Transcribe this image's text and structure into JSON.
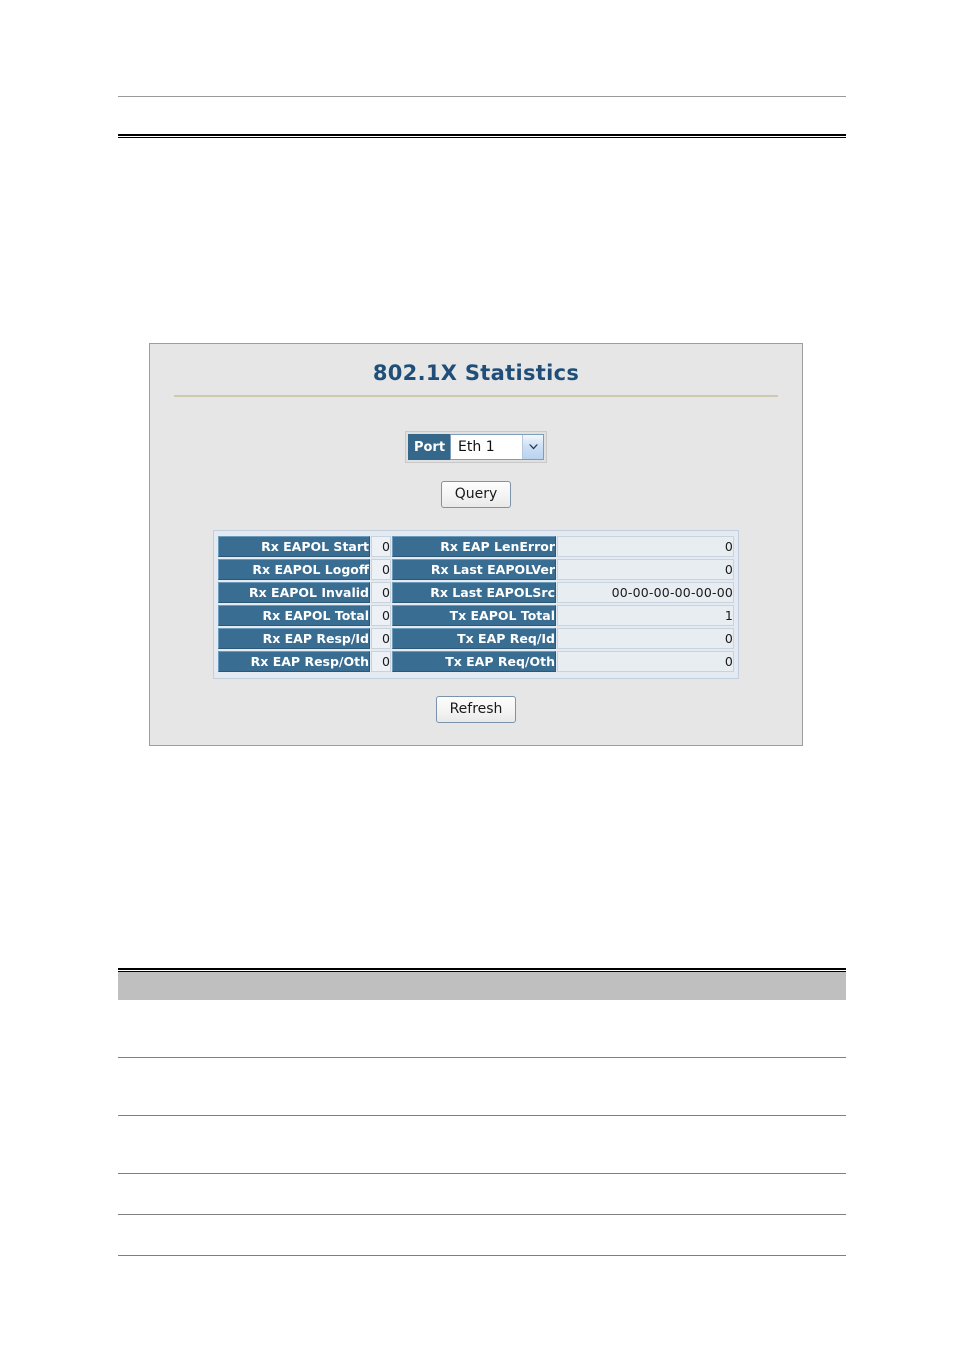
{
  "panel": {
    "title": "802.1X Statistics",
    "port": {
      "label": "Port",
      "selected_option": "Eth 1",
      "arrow_icon": "chevron-down-icon"
    },
    "buttons": {
      "query": "Query",
      "refresh": "Refresh"
    },
    "stats_table": {
      "rows": [
        {
          "left_label": "Rx EAPOL Start",
          "left_value": "0",
          "right_label": "Rx EAP LenError",
          "right_value": "0"
        },
        {
          "left_label": "Rx EAPOL Logoff",
          "left_value": "0",
          "right_label": "Rx Last EAPOLVer",
          "right_value": "0"
        },
        {
          "left_label": "Rx EAPOL Invalid",
          "left_value": "0",
          "right_label": "Rx Last EAPOLSrc",
          "right_value": "00-00-00-00-00-00"
        },
        {
          "left_label": "Rx EAPOL Total",
          "left_value": "0",
          "right_label": "Tx EAPOL Total",
          "right_value": "1"
        },
        {
          "left_label": "Rx EAP Resp/Id",
          "left_value": "0",
          "right_label": "Tx EAP Req/Id",
          "right_value": "0"
        },
        {
          "left_label": "Rx EAP Resp/Oth",
          "left_value": "0",
          "right_label": "Tx EAP Req/Oth",
          "right_value": "0"
        }
      ]
    }
  },
  "colors": {
    "title_blue": "#1f4e79",
    "header_cell_blue": "#3a6d92",
    "panel_background": "#e6e6e6",
    "title_rule_tan": "#cfc9ae",
    "doc_band_gray": "#bfbfbf"
  }
}
